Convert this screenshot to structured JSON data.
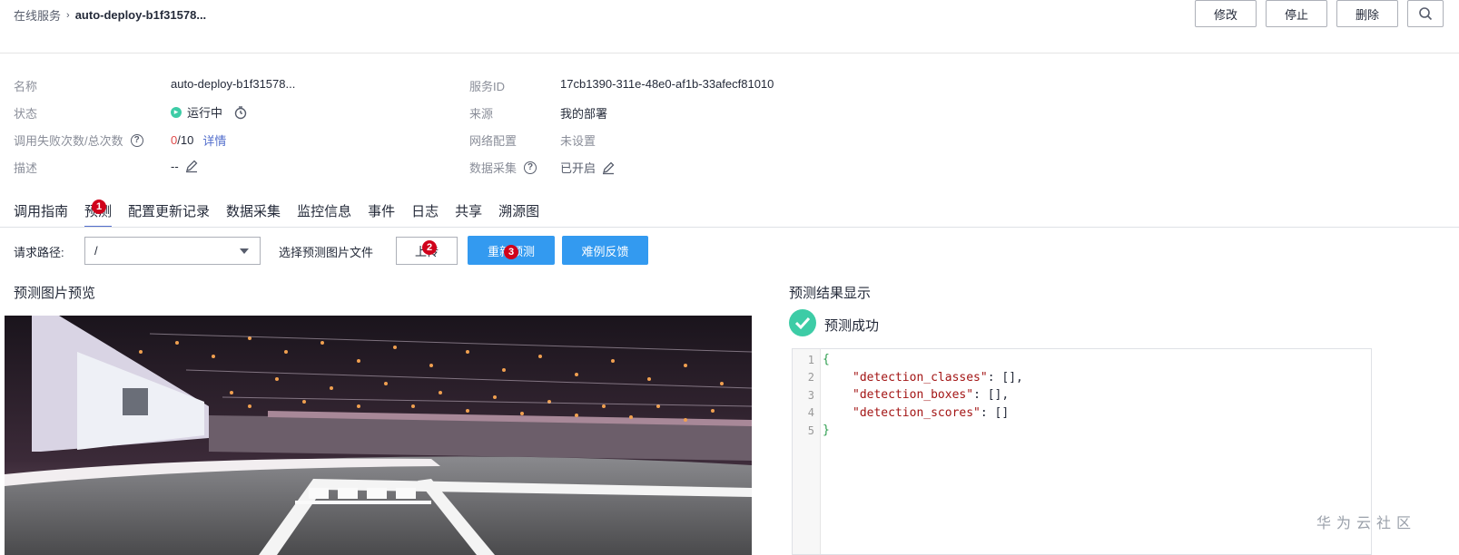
{
  "breadcrumb": {
    "parent": "在线服务",
    "separator": "›",
    "current": "auto-deploy-b1f31578..."
  },
  "header_buttons": {
    "modify": "修改",
    "stop": "停止",
    "delete": "删除"
  },
  "info": {
    "name_label": "名称",
    "name_value": "auto-deploy-b1f31578...",
    "status_label": "状态",
    "status_value": "运行中",
    "calls_label": "调用失败次数/总次数",
    "calls_failed": "0",
    "calls_total": " /10",
    "calls_link": "详情",
    "desc_label": "描述",
    "desc_value": "--",
    "service_id_label": "服务ID",
    "service_id_value": "17cb1390-311e-48e0-af1b-33afecf81010",
    "source_label": "来源",
    "source_value": "我的部署",
    "network_label": "网络配置",
    "network_value": "未设置",
    "data_collect_label": "数据采集",
    "data_collect_value": "已开启"
  },
  "tabs": [
    {
      "label": "调用指南"
    },
    {
      "label": "预测"
    },
    {
      "label": "配置更新记录"
    },
    {
      "label": "数据采集"
    },
    {
      "label": "监控信息"
    },
    {
      "label": "事件"
    },
    {
      "label": "日志"
    },
    {
      "label": "共享"
    },
    {
      "label": "溯源图"
    }
  ],
  "badges": [
    "1",
    "2",
    "3"
  ],
  "request": {
    "path_label": "请求路径:",
    "path_value": "/",
    "file_label": "选择预测图片文件",
    "upload_label": "上传",
    "repredict_label": "重新预测",
    "feedback_label": "难例反馈"
  },
  "preview": {
    "title": "预测图片预览"
  },
  "result": {
    "title": "预测结果显示",
    "success_text": "预测成功",
    "line_numbers": [
      "1",
      "2",
      "3",
      "4",
      "5"
    ],
    "open_brace": "{",
    "close_brace": "}",
    "keys": [
      "\"detection_classes\"",
      "\"detection_boxes\"",
      "\"detection_scores\""
    ],
    "vals": [
      ": [],",
      ": [],",
      ": []"
    ]
  },
  "watermark": "华为云社区",
  "icons": [
    "chevron-right-icon",
    "help-icon",
    "clock-icon",
    "edit-icon",
    "check-icon",
    "caret-down-icon",
    "search-icon"
  ],
  "colors": {
    "primary": "#339af0",
    "success": "#3dcca6",
    "link": "#526ecc",
    "badge": "#d0021b",
    "fail": "#e04b4b"
  }
}
